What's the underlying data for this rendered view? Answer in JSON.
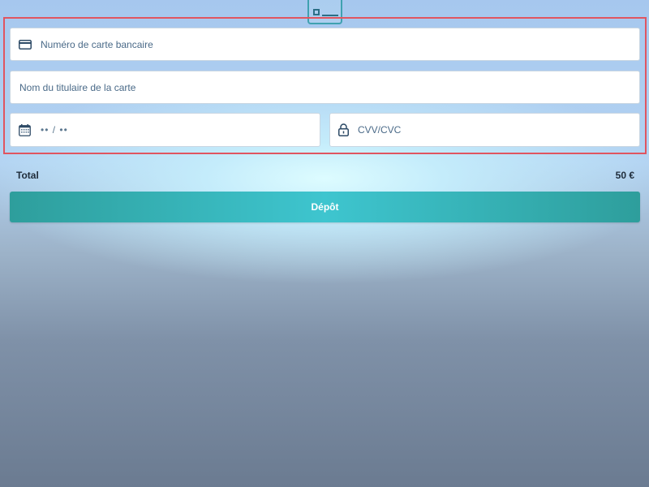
{
  "header": {
    "icon": "credit-card-icon"
  },
  "form": {
    "card_number": {
      "placeholder": "Numéro de carte bancaire",
      "icon": "credit-card-icon"
    },
    "card_holder": {
      "placeholder": "Nom du titulaire de la carte"
    },
    "expiry": {
      "placeholder": "•• / ••",
      "icon": "calendar-icon"
    },
    "cvv": {
      "placeholder": "CVV/CVC",
      "icon": "lock-icon"
    }
  },
  "summary": {
    "total_label": "Total",
    "total_value": "50 €"
  },
  "actions": {
    "deposit_label": "Dépôt"
  },
  "colors": {
    "accent": "#3ec5cf",
    "highlight_border": "#e05560",
    "field_border": "#c9d6e2"
  }
}
